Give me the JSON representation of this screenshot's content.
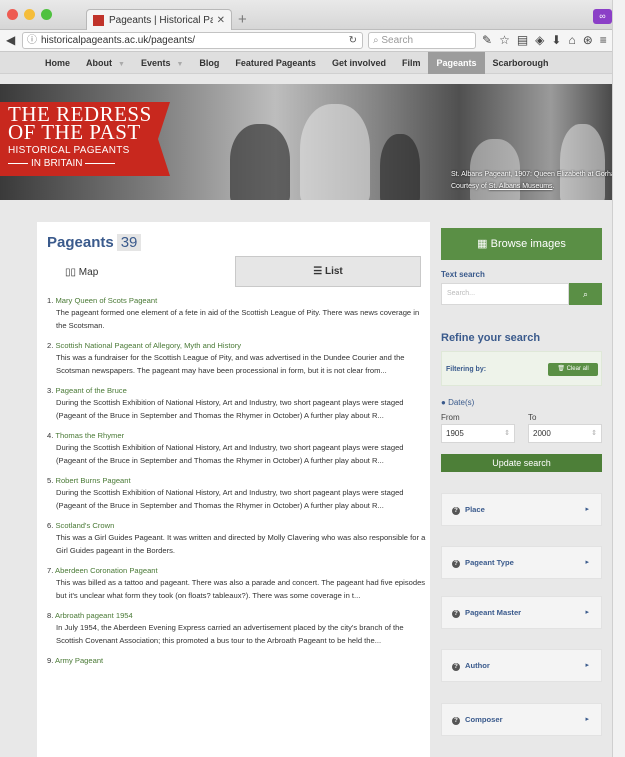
{
  "browser": {
    "tab_title": "Pageants | Historical Pages...",
    "url": "historicalpageants.ac.uk/pageants/",
    "search_placeholder": "Search",
    "toolbar_icons": [
      "wrench-icon",
      "star-icon",
      "clipboard-icon",
      "shield-icon",
      "download-icon",
      "home-icon",
      "extension-icon",
      "menu-icon"
    ]
  },
  "nav": {
    "items": [
      "Home",
      "About",
      "Events",
      "Blog",
      "Featured Pageants",
      "Get involved",
      "Film",
      "Pageants",
      "Scarborough"
    ],
    "active": "Pageants"
  },
  "banner": {
    "logo_line1": "THE REDRESS",
    "logo_line2": "OF THE PAST",
    "logo_line3": "HISTORICAL PAGEANTS",
    "logo_line4": "IN BRITAIN",
    "caption_line1": "St. Albans Pageant, 1907: Queen Elizabeth at Gorhambury.",
    "caption_line2_prefix": "Courtesy of ",
    "caption_link": "St. Albans Museums",
    "caption_line2_suffix": "."
  },
  "main": {
    "title": "Pageants",
    "count": "39",
    "map_label": "Map",
    "list_label": "List",
    "pageants": [
      {
        "num": "1.",
        "title": "Mary Queen of Scots Pageant",
        "desc": "The pageant formed one element of a fete in aid of the Scottish League of Pity. There was news coverage in the Scotsman."
      },
      {
        "num": "2.",
        "title": "Scottish National Pageant of Allegory, Myth and History",
        "desc": "This was a fundraiser for the Scottish League of Pity, and was advertised in the Dundee Courier and the Scotsman newspapers. The pageant may have been processional in form, but it is not clear from..."
      },
      {
        "num": "3.",
        "title": "Pageant of the Bruce",
        "desc": "During the Scottish Exhibition of National History, Art and Industry, two short pageant plays were staged (Pageant of the Bruce in September and Thomas the Rhymer in October) A further play about R..."
      },
      {
        "num": "4.",
        "title": "Thomas the Rhymer",
        "desc": "During the Scottish Exhibition of National History, Art and Industry, two short pageant plays were staged (Pageant of the Bruce in September and Thomas the Rhymer in October) A further play about R..."
      },
      {
        "num": "5.",
        "title": "Robert Burns Pageant",
        "desc": "During the Scottish Exhibition of National History, Art and Industry, two short pageant plays were staged (Pageant of the Bruce in September and Thomas the Rhymer in October) A further play about R..."
      },
      {
        "num": "6.",
        "title": "Scotland's Crown",
        "desc": "This was a Girl Guides Pageant. It was written and directed by Molly Clavering who was also responsible for a Girl Guides pageant in the Borders."
      },
      {
        "num": "7.",
        "title": "Aberdeen Coronation Pageant",
        "desc": "This was billed as a tattoo and pageant. There was also a parade and concert. The pageant had five episodes but it's unclear what form they took (on floats? tableaux?). There was some coverage in t..."
      },
      {
        "num": "8.",
        "title": "Arbroath pageant 1954",
        "desc": "In July 1954, the Aberdeen Evening Express carried an advertisement placed by the city's branch of the Scottish Covenant Association; this promoted a bus tour to the Arbroath Pageant to be held the..."
      },
      {
        "num": "9.",
        "title": "Army Pageant",
        "desc": ""
      }
    ]
  },
  "sidebar": {
    "browse_label": "Browse images",
    "text_search_label": "Text search",
    "search_placeholder": "Search...",
    "refine_title": "Refine your search",
    "filtering_label": "Filtering by:",
    "clear_all": "Clear all",
    "dates_label": "Date(s)",
    "from_label": "From",
    "to_label": "To",
    "from_value": "1905",
    "to_value": "2000",
    "update_label": "Update search",
    "facets": [
      "Place",
      "Pageant Type",
      "Pageant Master",
      "Author",
      "Composer"
    ]
  },
  "colors": {
    "accent_green": "#5a8f45",
    "title_blue": "#3a5a8c",
    "logo_red": "#c8281e"
  }
}
